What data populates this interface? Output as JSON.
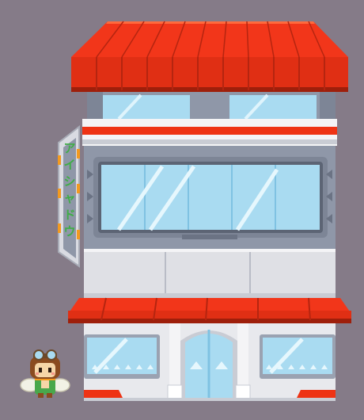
{
  "scene": {
    "background_color": "#857b88"
  },
  "building": {
    "awning_color": "#ee3314",
    "awning_shadow_color": "#b52510",
    "wall_color": "#8f97a8",
    "window_color": "#a9dbf1",
    "panel_color": "#dfe0e5",
    "floors": 3
  },
  "sign": {
    "text": "アイシャドウ",
    "text_color": "#3fae46",
    "accent_color": "#f39a1f",
    "orientation": "vertical"
  },
  "character": {
    "name_icon": "aviator-goggles-character",
    "outfit_color": "#49a84c",
    "hair_color": "#8a4b1f",
    "wing_color": "#f2f2e6"
  }
}
